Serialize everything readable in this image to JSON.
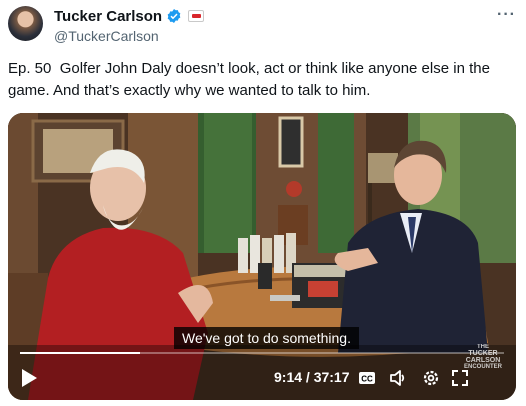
{
  "author": {
    "name": "Tucker Carlson",
    "handle": "@TuckerCarlson"
  },
  "tweet": {
    "text": "Ep. 50  Golfer John Daly doesn’t look, act or think like anyone else in the game. And that’s exactly why we wanted to talk to him."
  },
  "video": {
    "caption": "We've got to do something.",
    "time": "9:14 / 37:17",
    "progress": 0.248,
    "controls": [
      "play-icon",
      "captions-icon",
      "volume-icon",
      "settings-icon",
      "fullscreen-icon"
    ],
    "watermark_lines": [
      "THE",
      "TUCKER CARLSON",
      "ENCOUNTER"
    ]
  },
  "colors": {
    "verified": "#1d9bf0",
    "text": "#0f1419",
    "secondary": "#536471",
    "affiliate": "#d8262b"
  }
}
